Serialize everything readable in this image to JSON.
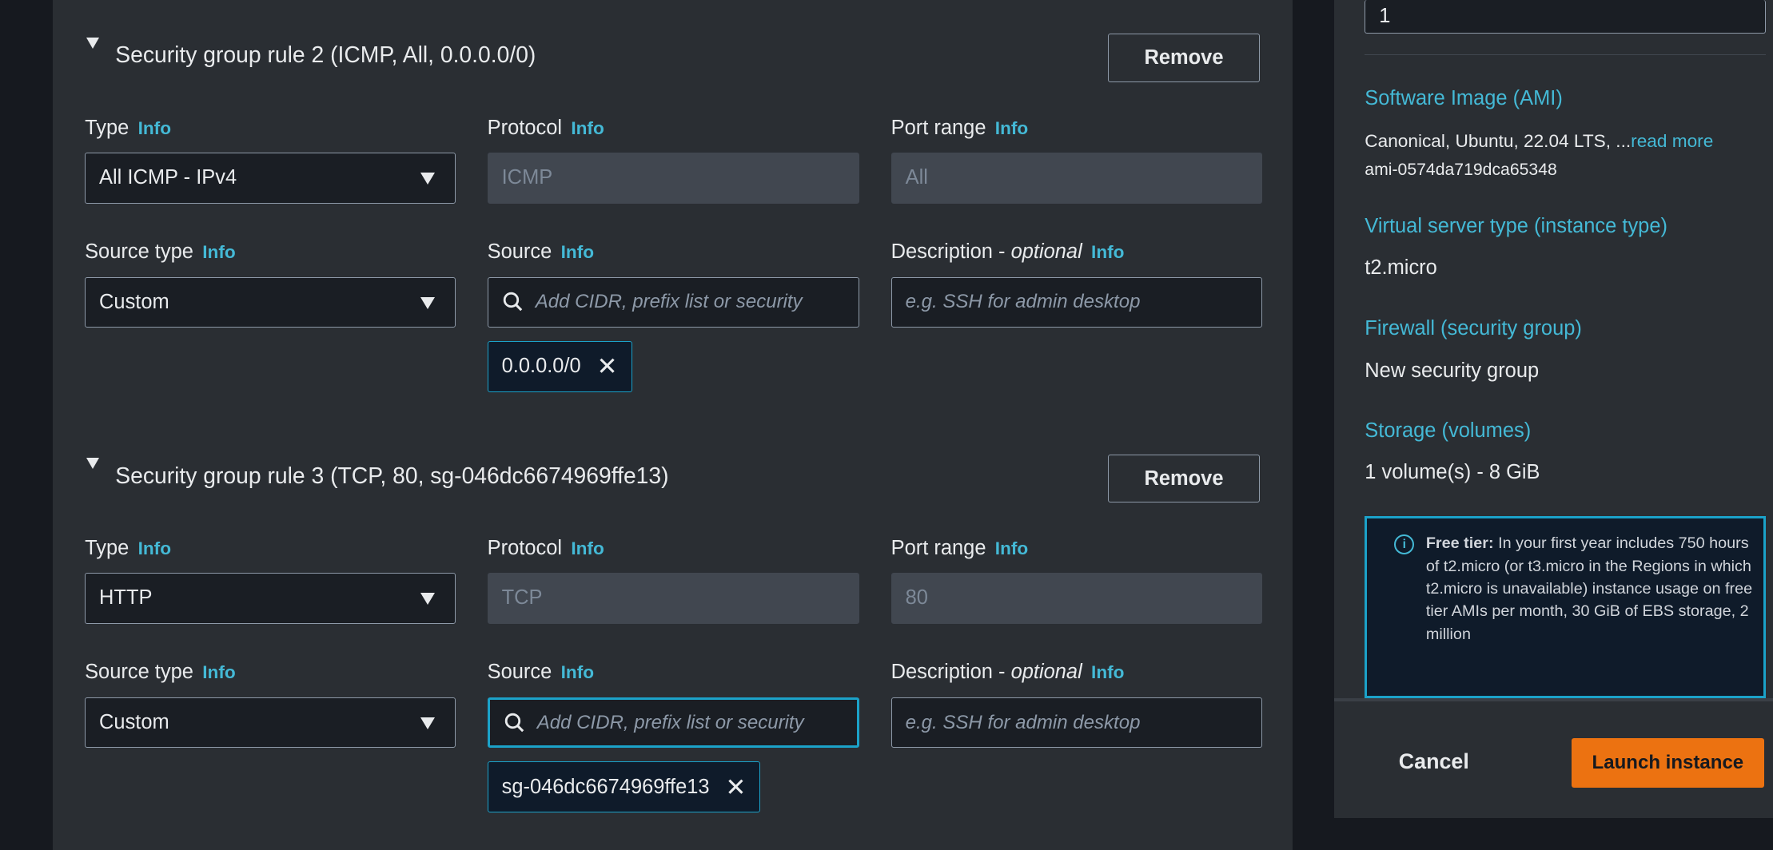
{
  "rules": [
    {
      "title": "Security group rule 2 (ICMP, All, 0.0.0.0/0)",
      "remove": "Remove",
      "type_label": "Type",
      "protocol_label": "Protocol",
      "port_label": "Port range",
      "type_value": "All ICMP - IPv4",
      "protocol_value": "ICMP",
      "port_value": "All",
      "source_type_label": "Source type",
      "source_label": "Source",
      "desc_label": "Description - ",
      "desc_optional": "optional",
      "source_type_value": "Custom",
      "source_placeholder": "Add CIDR, prefix list or security",
      "desc_placeholder": "e.g. SSH for admin desktop",
      "token": "0.0.0.0/0"
    },
    {
      "title": "Security group rule 3 (TCP, 80, sg-046dc6674969ffe13)",
      "remove": "Remove",
      "type_label": "Type",
      "protocol_label": "Protocol",
      "port_label": "Port range",
      "type_value": "HTTP",
      "protocol_value": "TCP",
      "port_value": "80",
      "source_type_label": "Source type",
      "source_label": "Source",
      "desc_label": "Description - ",
      "desc_optional": "optional",
      "source_type_value": "Custom",
      "source_placeholder": "Add CIDR, prefix list or security",
      "desc_placeholder": "e.g. SSH for admin desktop",
      "token": "sg-046dc6674969ffe13"
    }
  ],
  "info_label": "Info",
  "summary": {
    "instances_value": "1",
    "ami_label": "Software Image (AMI)",
    "ami_value": "Canonical, Ubuntu, 22.04 LTS, ...",
    "ami_read_more": "read more",
    "ami_id": "ami-0574da719dca65348",
    "type_label": "Virtual server type (instance type)",
    "type_value": "t2.micro",
    "firewall_label": "Firewall (security group)",
    "firewall_value": "New security group",
    "storage_label": "Storage (volumes)",
    "storage_value": "1 volume(s) - 8 GiB",
    "free_tier_bold": "Free tier:",
    "free_tier_text": " In your first year includes 750 hours of t2.micro (or t3.micro in the Regions in which t2.micro is unavailable) instance usage on free tier AMIs per month, 30 GiB of EBS storage, 2 million"
  },
  "footer": {
    "cancel": "Cancel",
    "launch": "Launch instance"
  },
  "colors": {
    "accent": "#44b9d6",
    "launch": "#ec7211",
    "panel": "#2a2e33"
  }
}
